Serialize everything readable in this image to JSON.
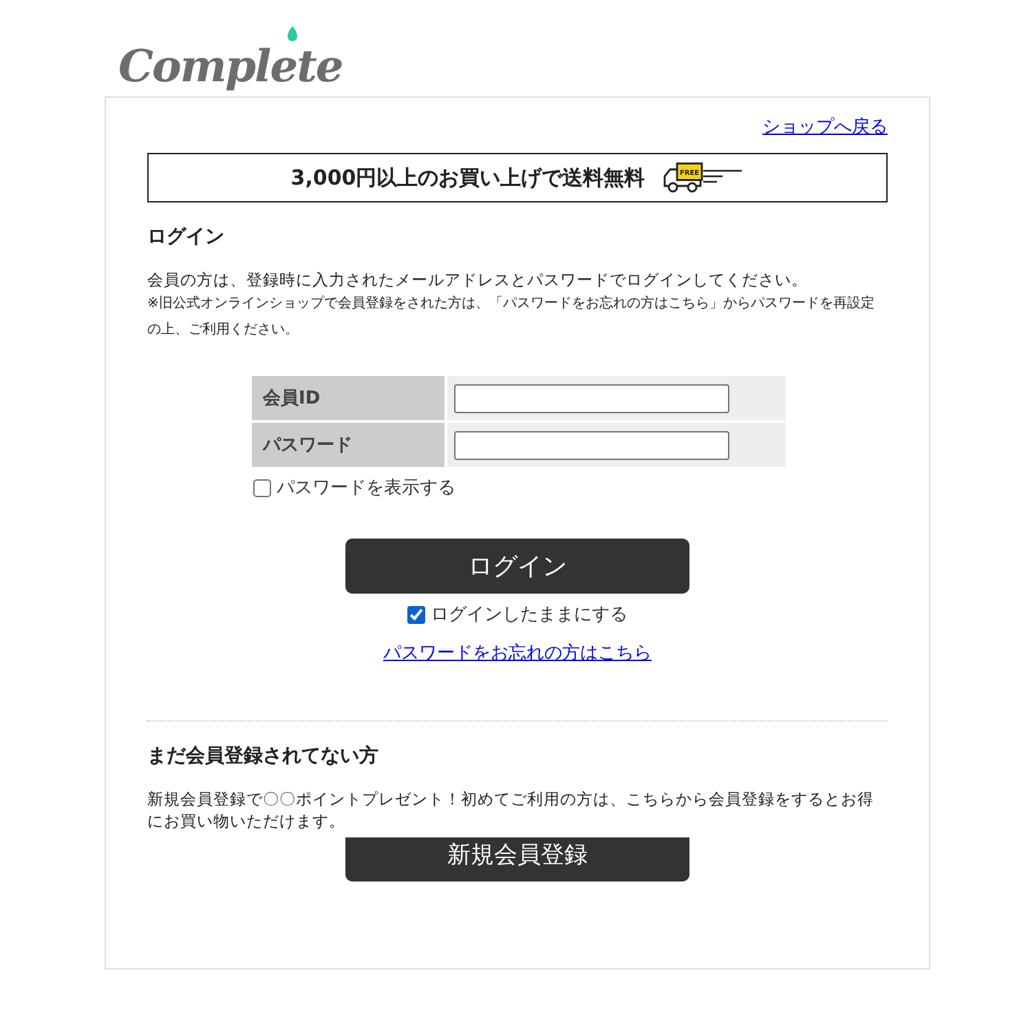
{
  "logo": {
    "text": "Complete"
  },
  "back_link": "ショップへ戻る",
  "shipping_banner": {
    "text": "3,000円以上のお買い上げで送料無料",
    "badge": "FREE"
  },
  "login": {
    "title": "ログイン",
    "description": "会員の方は、登録時に入力されたメールアドレスとパスワードでログインしてください。",
    "note": "※旧公式オンラインショップで会員登録をされた方は、「パスワードをお忘れの方はこちら」からパスワードを再設定の上、ご利用ください。",
    "fields": [
      {
        "label": "会員ID"
      },
      {
        "label": "パスワード"
      }
    ],
    "show_password": {
      "label": "パスワードを表示する",
      "checked": false
    },
    "submit": "ログイン",
    "stay_logged_in": {
      "label": "ログインしたままにする",
      "checked": true
    },
    "forgot_link": "パスワードをお忘れの方はこちら"
  },
  "register": {
    "title": "まだ会員登録されてない方",
    "description": "新規会員登録で〇〇ポイントプレゼント！初めてご利用の方は、こちらから会員登録をするとお得にお買い物いただけます。",
    "button": "新規会員登録"
  }
}
